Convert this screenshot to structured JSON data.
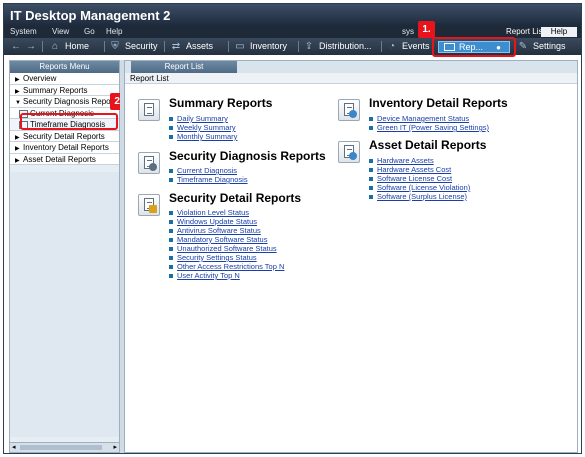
{
  "app": {
    "title": "IT Desktop Management 2"
  },
  "menu": {
    "system": "System",
    "view": "View",
    "go": "Go",
    "help": "Help",
    "sys_prefix": "sys",
    "report_list_link": "Report List",
    "help_button": "Help"
  },
  "toolbar": {
    "home": "Home",
    "security": "Security",
    "assets": "Assets",
    "inventory": "Inventory",
    "distribution": "Distribution...",
    "events": "Events",
    "reports": "Rep...",
    "settings": "Settings"
  },
  "callouts": {
    "one": "1.",
    "two": "2."
  },
  "left_panel": {
    "header": "Reports Menu",
    "items": [
      {
        "label": "Overview",
        "arrow": "▶"
      },
      {
        "label": "Summary Reports",
        "arrow": "▶"
      },
      {
        "label": "Security Diagnosis Reports",
        "arrow": "▼"
      },
      {
        "label": "Current Diagnosis",
        "arrow": ""
      },
      {
        "label": "Timeframe Diagnosis",
        "arrow": ""
      },
      {
        "label": "Security Detail Reports",
        "arrow": "▶"
      },
      {
        "label": "Inventory Detail Reports",
        "arrow": "▶"
      },
      {
        "label": "Asset Detail Reports",
        "arrow": "▶"
      }
    ],
    "scroll_left": "◂",
    "scroll_right": "▸"
  },
  "right_panel": {
    "tab": "Report List",
    "breadcrumb": "Report List",
    "sections": {
      "summary": {
        "title": "Summary Reports",
        "links": [
          "Daily Summary",
          "Weekly Summary",
          "Monthly Summary"
        ]
      },
      "security_diagnosis": {
        "title": "Security Diagnosis Reports",
        "links": [
          "Current Diagnosis",
          "Timeframe Diagnosis"
        ]
      },
      "security_detail": {
        "title": "Security Detail Reports",
        "links": [
          "Violation Level Status",
          "Windows Update Status",
          "Antivirus Software Status",
          "Mandatory Software Status",
          "Unauthorized Software Status",
          "Security Settings Status",
          "Other Access Restrictions Top N",
          "User Activity Top N"
        ]
      },
      "inventory_detail": {
        "title": "Inventory Detail Reports",
        "links": [
          "Device Management Status",
          "Green IT (Power Saving Settings)"
        ]
      },
      "asset_detail": {
        "title": "Asset Detail Reports",
        "links": [
          "Hardware Assets",
          "Hardware Assets Cost",
          "Software License Cost",
          "Software (License Violation)",
          "Software (Surplus License)"
        ]
      }
    }
  },
  "colors": {
    "callout": "#e8141b",
    "link": "#1a3fa8",
    "active_tab": "#3e8ecf"
  }
}
